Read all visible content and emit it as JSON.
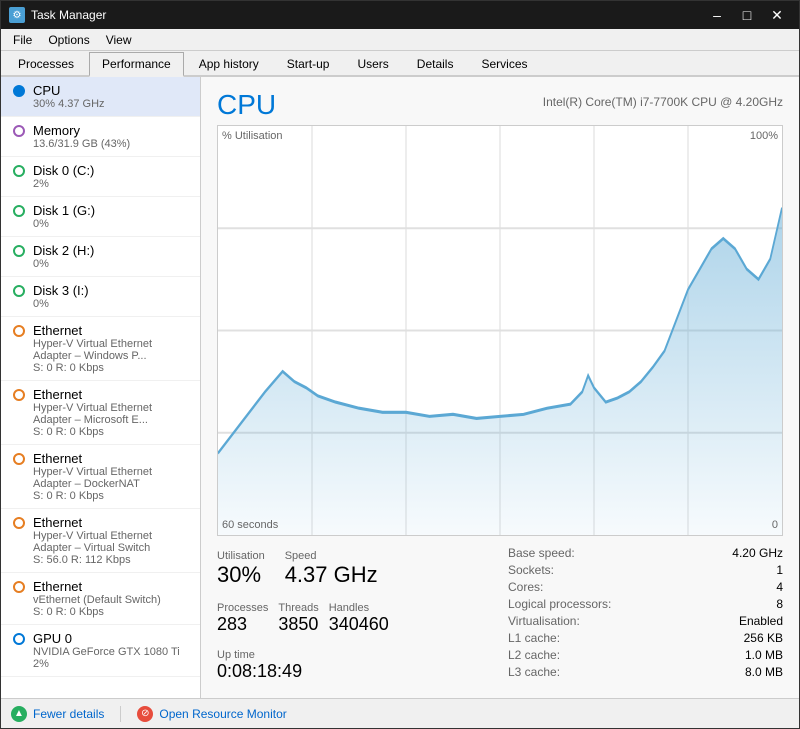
{
  "window": {
    "title": "Task Manager",
    "controls": {
      "minimize": "–",
      "maximize": "□",
      "close": "✕"
    }
  },
  "menu": {
    "items": [
      "File",
      "Options",
      "View"
    ]
  },
  "tabs": {
    "items": [
      "Processes",
      "Performance",
      "App history",
      "Start-up",
      "Users",
      "Details",
      "Services"
    ],
    "active": "Performance"
  },
  "sidebar": {
    "items": [
      {
        "id": "cpu",
        "name": "CPU",
        "value": "30% 4.37 GHz",
        "dot": "blue-filled",
        "active": true
      },
      {
        "id": "memory",
        "name": "Memory",
        "value": "13.6/31.9 GB (43%)",
        "dot": "purple"
      },
      {
        "id": "disk0",
        "name": "Disk 0 (C:)",
        "value": "2%",
        "dot": "green"
      },
      {
        "id": "disk1",
        "name": "Disk 1 (G:)",
        "value": "0%",
        "dot": "green"
      },
      {
        "id": "disk2",
        "name": "Disk 2 (H:)",
        "value": "0%",
        "dot": "green"
      },
      {
        "id": "disk3",
        "name": "Disk 3 (I:)",
        "value": "0%",
        "dot": "green"
      },
      {
        "id": "eth1",
        "name": "Ethernet",
        "value": "Hyper-V Virtual Ethernet Adapter – Windows P...\nS: 0 R: 0 Kbps",
        "dot": "orange"
      },
      {
        "id": "eth2",
        "name": "Ethernet",
        "value": "Hyper-V Virtual Ethernet Adapter – Microsoft E...\nS: 0 R: 0 Kbps",
        "dot": "orange"
      },
      {
        "id": "eth3",
        "name": "Ethernet",
        "value": "Hyper-V Virtual Ethernet Adapter – DockerNAT\nS: 0 R: 0 Kbps",
        "dot": "orange"
      },
      {
        "id": "eth4",
        "name": "Ethernet",
        "value": "Hyper-V Virtual Ethernet Adapter – Virtual Switch\nS: 56.0 R: 112 Kbps",
        "dot": "orange"
      },
      {
        "id": "eth5",
        "name": "Ethernet",
        "value": "vEthernet (Default Switch)\nS: 0 R: 0 Kbps",
        "dot": "orange"
      },
      {
        "id": "gpu0",
        "name": "GPU 0",
        "value": "NVIDIA GeForce GTX 1080 Ti\n2%",
        "dot": "blue"
      }
    ]
  },
  "main": {
    "title": "CPU",
    "subtitle": "Intel(R) Core(TM) i7-7700K CPU @ 4.20GHz",
    "chart": {
      "y_label": "% Utilisation",
      "y_max": "100%",
      "x_left": "60 seconds",
      "x_right": "0"
    },
    "stats": {
      "utilisation_label": "Utilisation",
      "utilisation_value": "30%",
      "speed_label": "Speed",
      "speed_value": "4.37 GHz",
      "processes_label": "Processes",
      "processes_value": "283",
      "threads_label": "Threads",
      "threads_value": "3850",
      "handles_label": "Handles",
      "handles_value": "340460",
      "uptime_label": "Up time",
      "uptime_value": "0:08:18:49"
    },
    "right_stats": {
      "base_speed_label": "Base speed:",
      "base_speed_value": "4.20 GHz",
      "sockets_label": "Sockets:",
      "sockets_value": "1",
      "cores_label": "Cores:",
      "cores_value": "4",
      "logical_label": "Logical processors:",
      "logical_value": "8",
      "virtualisation_label": "Virtualisation:",
      "virtualisation_value": "Enabled",
      "l1_label": "L1 cache:",
      "l1_value": "256 KB",
      "l2_label": "L2 cache:",
      "l2_value": "1.0 MB",
      "l3_label": "L3 cache:",
      "l3_value": "8.0 MB"
    }
  },
  "footer": {
    "fewer_details": "Fewer details",
    "open_resource_monitor": "Open Resource Monitor"
  }
}
